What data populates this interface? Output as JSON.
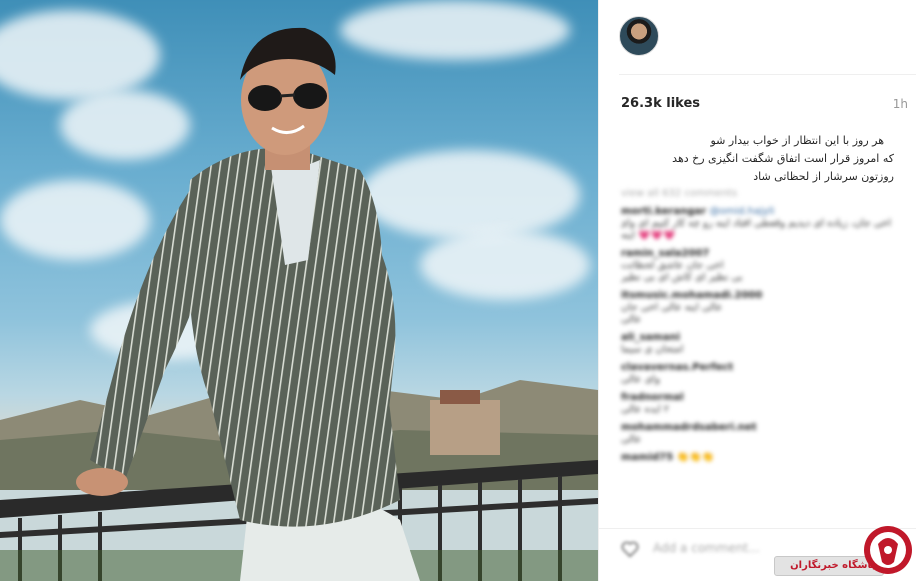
{
  "post": {
    "likes": "26.3k likes",
    "time_ago": "1h",
    "caption_lines": [
      "هر روز با این انتظار از خواب بیدار شو",
      "که امروز قرار است اتفاق شگفت انگیزی رخ دهد",
      "روزتون سرشار از لحظاتی شاد"
    ]
  },
  "comments": {
    "view_all": "view all 632 comments",
    "items": [
      {
        "user": "morti.kerangar",
        "mention": "@omid.hajyli",
        "text": "آخی جان، زیاده ای دیدیم وقعطی افتاد اینه رو چه کار کنیم ای وای جان",
        "extra": "💗💗💗 اینه"
      },
      {
        "user": "ramin_sala2007",
        "text": "آخی جان عاشق لحظاتت",
        "extra": "بی نظیر ای کاش ای بی نظیر"
      },
      {
        "user": "itsmusic.mohamadi.2000",
        "text": "عالی اینه عالی آخی جان",
        "extra": "عالی"
      },
      {
        "user": "ali_samani",
        "text": "امتحان ی سیما"
      },
      {
        "user": "clavavernas.Perfect",
        "text": "وای عالی"
      },
      {
        "user": "fradnormal",
        "text": "۲ ایده عالی"
      },
      {
        "user": "mohammadrdsaberi.net",
        "text": "عالی"
      },
      {
        "user": "mamid75",
        "text": "👏👏👏"
      }
    ],
    "add_comment_placeholder": "Add a comment..."
  },
  "watermark": {
    "banner_text": "باشگاه خبرنگاران"
  },
  "colors": {
    "watermark_red": "#c0182a",
    "text_primary": "#262626",
    "text_muted": "#999999"
  },
  "icons": {
    "avatar": "profile-photo",
    "heart": "heart-icon",
    "logo": "news-agency-logo"
  }
}
